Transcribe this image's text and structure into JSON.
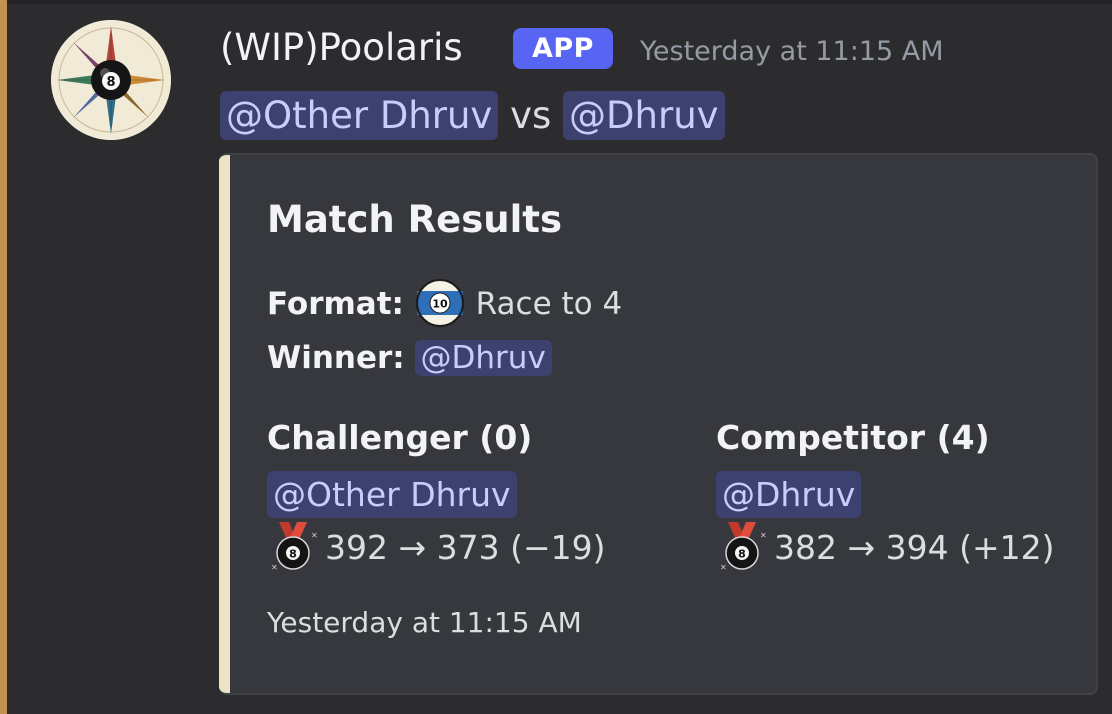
{
  "message": {
    "author": "(WIP)Poolaris",
    "badge": "APP",
    "timestamp": "Yesterday at 11:15 AM",
    "mention_one": "@Other Dhruv",
    "vs_text": "vs",
    "mention_two": "@Dhruv"
  },
  "embed": {
    "title": "Match Results",
    "format_label": "Format:",
    "format_ball_number": "10",
    "format_value": "Race to 4",
    "winner_label": "Winner:",
    "winner_mention": "@Dhruv",
    "challenger": {
      "title": "Challenger (0)",
      "mention": "@Other Dhruv",
      "rating": "392 → 373 (−19)"
    },
    "competitor": {
      "title": "Competitor (4)",
      "mention": "@Dhruv",
      "rating": "382 → 394 (+12)"
    },
    "footer_timestamp": "Yesterday at 11:15 AM"
  },
  "icons": {
    "avatar": "compass-eight-ball-icon",
    "format": "ten-ball-icon",
    "rating": "eight-ball-medal-icon"
  },
  "colors": {
    "accent_bar": "#c3924e",
    "embed_bar": "#ece3c5",
    "app_badge": "#5865f2",
    "mention_bg": "#3c4170",
    "mention_text": "#c9cdfb"
  }
}
